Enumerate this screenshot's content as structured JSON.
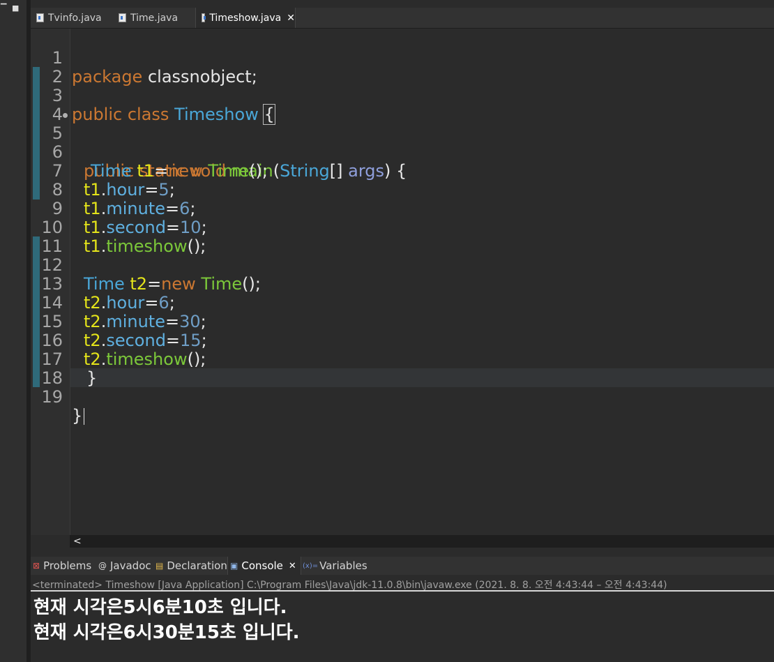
{
  "editor_tabs": [
    {
      "label": "Tvinfo.java",
      "active": false
    },
    {
      "label": "Time.java",
      "active": false
    },
    {
      "label": "Timeshow.java",
      "active": true
    }
  ],
  "code": {
    "line_numbers": [
      "1",
      "2",
      "3",
      "4",
      "5",
      "6",
      "7",
      "8",
      "9",
      "10",
      "11",
      "12",
      "13",
      "14",
      "15",
      "16",
      "17",
      "18",
      "19"
    ],
    "l1": {
      "kw": "package",
      "rest": " classnobject;"
    },
    "l3": {
      "kw": "public class",
      "name": "Timeshow",
      "brace": "{"
    },
    "l5": {
      "kw": "public static void",
      "fn": "main",
      "p1": "(",
      "type": "String",
      "arr": "[] ",
      "args": "args",
      "p2": ") {"
    },
    "l6": {
      "type": "Time",
      "var": "t1",
      "eq": "=",
      "kw": "new",
      "cls": "Time",
      "end": "();"
    },
    "l7": {
      "obj": "t1",
      "dot": ".",
      "field": "hour",
      "eq": "=",
      "num": "5",
      "end": ";"
    },
    "l8": {
      "obj": "t1",
      "dot": ".",
      "field": "minute",
      "eq": "=",
      "num": "6",
      "end": ";"
    },
    "l9": {
      "obj": "t1",
      "dot": ".",
      "field": "second",
      "eq": "=",
      "num": "10",
      "end": ";"
    },
    "l10": {
      "obj": "t1",
      "dot": ".",
      "fn": "timeshow",
      "end": "();"
    },
    "l12": {
      "type": "Time",
      "var": "t2",
      "eq": "=",
      "kw": "new",
      "cls": "Time",
      "end": "();"
    },
    "l13": {
      "obj": "t2",
      "dot": ".",
      "field": "hour",
      "eq": "=",
      "num": "6",
      "end": ";"
    },
    "l14": {
      "obj": "t2",
      "dot": ".",
      "field": "minute",
      "eq": "=",
      "num": "30",
      "end": ";"
    },
    "l15": {
      "obj": "t2",
      "dot": ".",
      "field": "second",
      "eq": "=",
      "num": "15",
      "end": ";"
    },
    "l16": {
      "obj": "t2",
      "dot": ".",
      "fn": "timeshow",
      "end": "();"
    },
    "l17": {
      "text": "}"
    },
    "l19": {
      "text": "}"
    }
  },
  "hscroll": {
    "arrow": "<"
  },
  "panel_tabs": [
    {
      "label": "Problems",
      "icon": "problems-icon",
      "active": false
    },
    {
      "label": "Javadoc",
      "icon": "javadoc-icon",
      "active": false
    },
    {
      "label": "Declaration",
      "icon": "declaration-icon",
      "active": false
    },
    {
      "label": "Console",
      "icon": "console-icon",
      "active": true
    },
    {
      "label": "Variables",
      "icon": "variables-icon",
      "active": false
    }
  ],
  "console": {
    "header": "<terminated> Timeshow [Java Application] C:\\Program Files\\Java\\jdk-11.0.8\\bin\\javaw.exe  (2021. 8. 8. 오전 4:43:44 – 오전 4:43:44)",
    "output": [
      "현재 시각은5시6분10초 입니다.",
      "현재 시각은6시30분15초 입니다."
    ]
  },
  "colors": {
    "keyword": "#cc7832",
    "type": "#4aa7d8",
    "variable": "#e4e41a",
    "method": "#7cc83a",
    "number": "#6f9ec6",
    "background": "#2b2b2b"
  }
}
